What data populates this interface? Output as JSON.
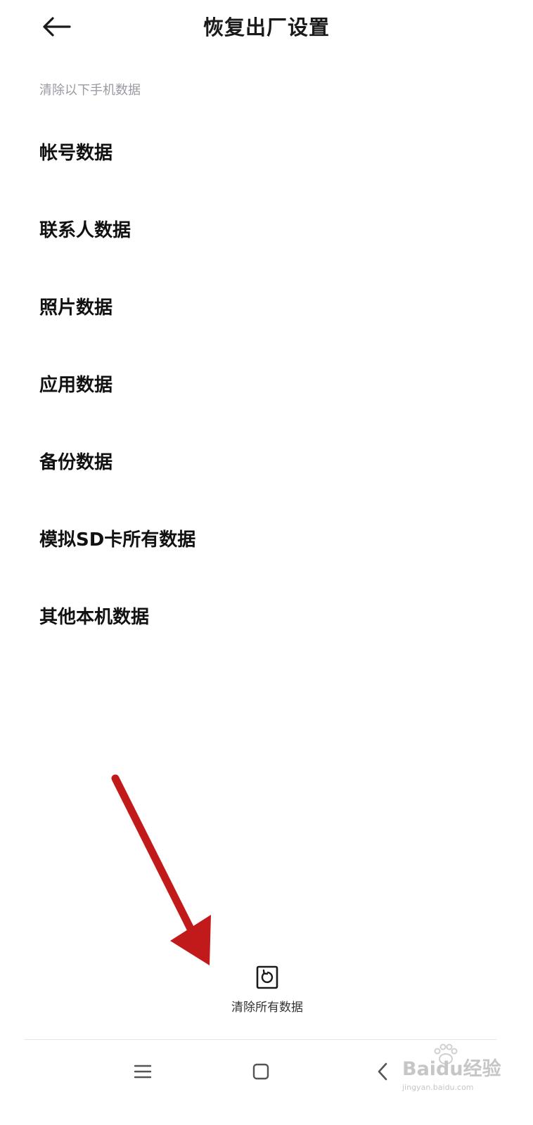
{
  "header": {
    "back_icon": "arrow-left-icon",
    "title": "恢复出厂设置"
  },
  "section_caption": "清除以下手机数据",
  "data_items": [
    {
      "label": "帐号数据"
    },
    {
      "label": "联系人数据"
    },
    {
      "label": "照片数据"
    },
    {
      "label": "应用数据"
    },
    {
      "label": "备份数据"
    },
    {
      "label": "模拟SD卡所有数据"
    },
    {
      "label": "其他本机数据"
    }
  ],
  "annotation": {
    "arrow_icon": "red-arrow-annotation",
    "color": "#c21a1a"
  },
  "clear_all": {
    "icon": "reset-icon",
    "label": "清除所有数据"
  },
  "nav_bar": {
    "menu_icon": "menu-icon",
    "home_icon": "home-icon",
    "back_icon": "back-chevron-icon"
  },
  "watermark": {
    "main": "Baidu经验",
    "sub": "jingyan.baidu.com"
  }
}
